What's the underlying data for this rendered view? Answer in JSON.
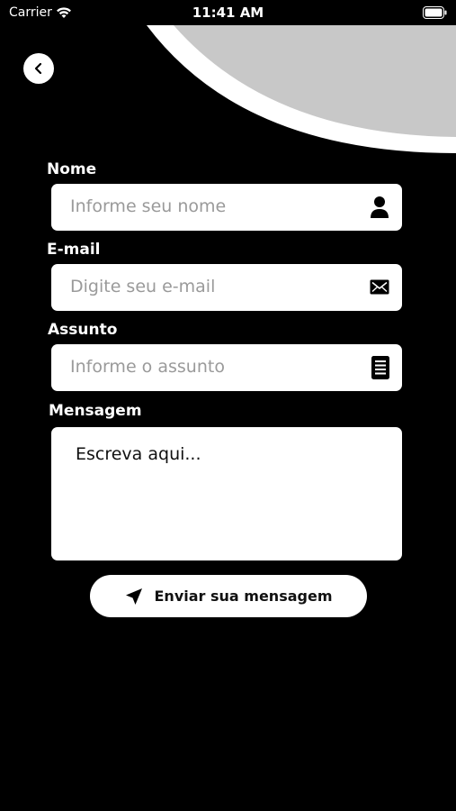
{
  "status_bar": {
    "carrier": "Carrier",
    "time": "11:41 AM"
  },
  "form": {
    "name": {
      "label": "Nome",
      "placeholder": "Informe seu nome",
      "icon": "user-icon"
    },
    "email": {
      "label": "E-mail",
      "placeholder": "Digite seu e-mail",
      "icon": "envelope-icon"
    },
    "subject": {
      "label": "Assunto",
      "placeholder": "Informe o assunto",
      "icon": "document-icon"
    },
    "message": {
      "label": "Mensagem",
      "placeholder": "Escreva aqui..."
    },
    "submit_label": "Enviar sua mensagem"
  },
  "colors": {
    "background": "#000000",
    "field_background": "#ffffff",
    "decor_arc": "#c8c8c8"
  }
}
